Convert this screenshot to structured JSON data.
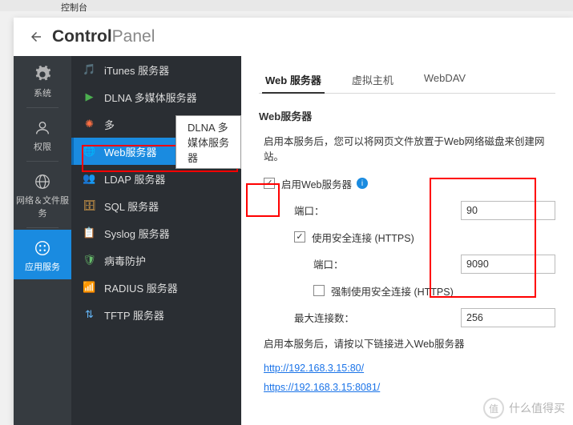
{
  "topbar": {
    "label": "控制台"
  },
  "title": {
    "bold": "Control",
    "light": "Panel"
  },
  "rail": {
    "system": "系统",
    "perm": "权限",
    "netfile": "网络＆文件服务",
    "appsvc": "应用服务"
  },
  "menu": {
    "itunes": "iTunes 服务器",
    "dlna": "DLNA 多媒体服务器",
    "multi": "多",
    "web": "Web服务器",
    "ldap": "LDAP 服务器",
    "sql": "SQL 服务器",
    "syslog": "Syslog 服务器",
    "antivirus": "病毒防护",
    "radius": "RADIUS 服务器",
    "tftp": "TFTP 服务器"
  },
  "tooltip": "DLNA 多媒体服务器",
  "tabs": {
    "web": "Web 服务器",
    "vhost": "虚拟主机",
    "webdav": "WebDAV"
  },
  "section": {
    "title": "Web服务器",
    "desc": "启用本服务后，您可以将网页文件放置于Web网络磁盘来创建网站。",
    "enable": "启用Web服务器",
    "port": "端口：",
    "port_val": "90",
    "https": "使用安全连接 (HTTPS)",
    "https_port": "端口：",
    "https_port_val": "9090",
    "force_https": "强制使用安全连接 (HTTPS)",
    "max_conn": "最大连接数：",
    "max_conn_val": "256",
    "link_desc": "启用本服务后，请按以下链接进入Web服务器",
    "link1": "http://192.168.3.15:80/",
    "link2": "https://192.168.3.15:8081/"
  },
  "watermark": {
    "logo": "值",
    "text": "什么值得买"
  }
}
